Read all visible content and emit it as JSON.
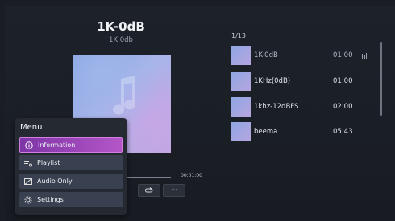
{
  "now_playing": {
    "title": "1K-0dB",
    "subtitle": "1K 0db"
  },
  "player": {
    "total_time": "00:01:00",
    "controls": [
      {
        "name": "repeat-button",
        "icon": "repeat-icon"
      },
      {
        "name": "more-options-button",
        "icon": "ellipsis-icon"
      }
    ]
  },
  "menu": {
    "title": "Menu",
    "items": [
      {
        "label": "Information",
        "icon": "info-icon",
        "active": true
      },
      {
        "label": "Playlist",
        "icon": "playlist-icon",
        "active": false
      },
      {
        "label": "Audio Only",
        "icon": "audio-only-icon",
        "active": false
      },
      {
        "label": "Settings",
        "icon": "gear-icon",
        "active": false
      }
    ]
  },
  "playlist": {
    "count": "1/13",
    "items": [
      {
        "name": "1K-0dB",
        "duration": "01:00",
        "playing": true
      },
      {
        "name": "1KHz(0dB)",
        "duration": "01:00",
        "playing": false
      },
      {
        "name": "1khz-12dBFS",
        "duration": "02:00",
        "playing": false
      },
      {
        "name": "beema",
        "duration": "05:43",
        "playing": false
      }
    ]
  },
  "colors": {
    "background": "#1a1d24",
    "menu_active": "#b456c8",
    "menu_item": "#394150"
  }
}
